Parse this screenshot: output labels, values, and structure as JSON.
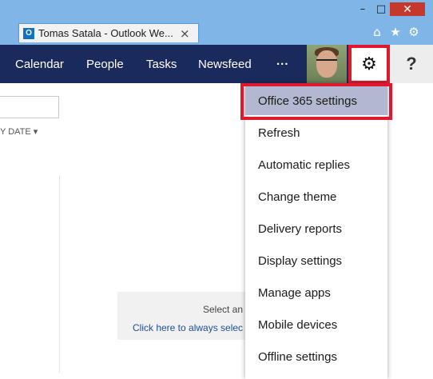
{
  "browser": {
    "tab_title": "Tomas Satala - Outlook We...",
    "tab_favicon": "O",
    "tab_close": "×",
    "window_controls": {
      "minimize": "–",
      "maximize": "□",
      "close": "✕"
    },
    "toolbar_icons": [
      "home-icon",
      "star-icon",
      "gear-icon"
    ],
    "toolbar_glyphs": {
      "home": "⌂",
      "star": "★",
      "settings": "⚙"
    }
  },
  "nav": {
    "items": [
      "Calendar",
      "People",
      "Tasks",
      "Newsfeed"
    ],
    "more": "...",
    "settings_glyph": "⚙",
    "help": "?"
  },
  "main": {
    "sort_label": "Y DATE ▾",
    "reading_pane_text": "Select an",
    "reading_pane_link": "Click here to always selec"
  },
  "settings_menu": {
    "items": [
      "Office 365 settings",
      "Refresh",
      "Automatic replies",
      "Change theme",
      "Delivery reports",
      "Display settings",
      "Manage apps",
      "Mobile devices",
      "Offline settings"
    ],
    "selected_index": 0
  },
  "colors": {
    "nav_background": "#1b2a5c",
    "chrome_background": "#7fb6e7",
    "highlight_border": "#e0182d",
    "selected_item": "#b2b8cf"
  }
}
